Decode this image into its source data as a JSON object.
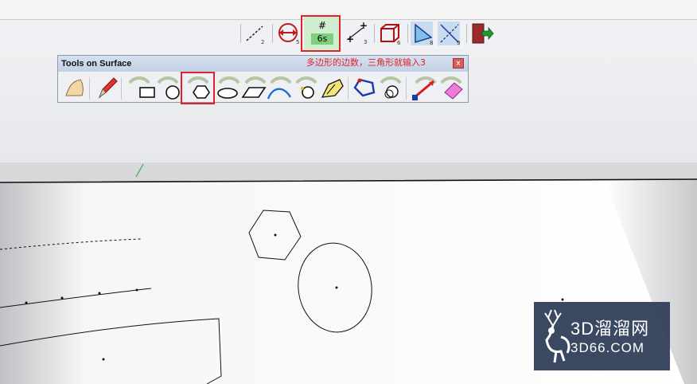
{
  "toolbar": {
    "measure_label_value": "6s",
    "measure_label_symbol": "#",
    "tool_subscripts": [
      "2",
      "5",
      "3",
      "6",
      "8",
      "9"
    ]
  },
  "tools_panel": {
    "title": "Tools on Surface",
    "annotation": "多边形的边数，三角形就输入3",
    "close_symbol": "x",
    "tools": [
      "surface-icon",
      "pencil-icon",
      "rectangle-icon",
      "circle-icon",
      "polygon-icon",
      "ellipse-icon",
      "parallelogram-icon",
      "arc-icon",
      "circle-point-icon",
      "offset-icon",
      "outer-shell-icon",
      "geodesic-icon",
      "line-icon",
      "eraser-icon"
    ]
  },
  "watermark": {
    "title": "3D溜溜网",
    "url": "3D66.COM"
  },
  "colors": {
    "highlight": "#e0212a",
    "panel_title_bg": "#c9d6e9",
    "input_box_bg": "#cfeecf",
    "watermark_bg": "#2d3b57"
  }
}
